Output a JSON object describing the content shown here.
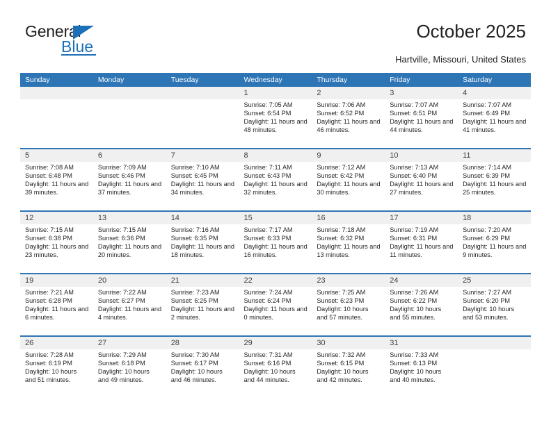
{
  "brand": {
    "name_top": "General",
    "name_bottom": "Blue",
    "accent_color": "#1c70b8",
    "triangle_icon": "blue-triangle-icon"
  },
  "header": {
    "title": "October 2025",
    "subtitle": "Hartville, Missouri, United States"
  },
  "theme": {
    "header_row_bg": "#2e75b6",
    "daynum_bg": "#f0f0f0",
    "text_color": "#262626"
  },
  "weekdays": [
    "Sunday",
    "Monday",
    "Tuesday",
    "Wednesday",
    "Thursday",
    "Friday",
    "Saturday"
  ],
  "weeks": [
    [
      {
        "day": "",
        "lines": []
      },
      {
        "day": "",
        "lines": []
      },
      {
        "day": "",
        "lines": []
      },
      {
        "day": "1",
        "lines": [
          "Sunrise: 7:05 AM",
          "Sunset: 6:54 PM",
          "Daylight: 11 hours and 48 minutes."
        ]
      },
      {
        "day": "2",
        "lines": [
          "Sunrise: 7:06 AM",
          "Sunset: 6:52 PM",
          "Daylight: 11 hours and 46 minutes."
        ]
      },
      {
        "day": "3",
        "lines": [
          "Sunrise: 7:07 AM",
          "Sunset: 6:51 PM",
          "Daylight: 11 hours and 44 minutes."
        ]
      },
      {
        "day": "4",
        "lines": [
          "Sunrise: 7:07 AM",
          "Sunset: 6:49 PM",
          "Daylight: 11 hours and 41 minutes."
        ]
      }
    ],
    [
      {
        "day": "5",
        "lines": [
          "Sunrise: 7:08 AM",
          "Sunset: 6:48 PM",
          "Daylight: 11 hours and 39 minutes."
        ]
      },
      {
        "day": "6",
        "lines": [
          "Sunrise: 7:09 AM",
          "Sunset: 6:46 PM",
          "Daylight: 11 hours and 37 minutes."
        ]
      },
      {
        "day": "7",
        "lines": [
          "Sunrise: 7:10 AM",
          "Sunset: 6:45 PM",
          "Daylight: 11 hours and 34 minutes."
        ]
      },
      {
        "day": "8",
        "lines": [
          "Sunrise: 7:11 AM",
          "Sunset: 6:43 PM",
          "Daylight: 11 hours and 32 minutes."
        ]
      },
      {
        "day": "9",
        "lines": [
          "Sunrise: 7:12 AM",
          "Sunset: 6:42 PM",
          "Daylight: 11 hours and 30 minutes."
        ]
      },
      {
        "day": "10",
        "lines": [
          "Sunrise: 7:13 AM",
          "Sunset: 6:40 PM",
          "Daylight: 11 hours and 27 minutes."
        ]
      },
      {
        "day": "11",
        "lines": [
          "Sunrise: 7:14 AM",
          "Sunset: 6:39 PM",
          "Daylight: 11 hours and 25 minutes."
        ]
      }
    ],
    [
      {
        "day": "12",
        "lines": [
          "Sunrise: 7:15 AM",
          "Sunset: 6:38 PM",
          "Daylight: 11 hours and 23 minutes."
        ]
      },
      {
        "day": "13",
        "lines": [
          "Sunrise: 7:15 AM",
          "Sunset: 6:36 PM",
          "Daylight: 11 hours and 20 minutes."
        ]
      },
      {
        "day": "14",
        "lines": [
          "Sunrise: 7:16 AM",
          "Sunset: 6:35 PM",
          "Daylight: 11 hours and 18 minutes."
        ]
      },
      {
        "day": "15",
        "lines": [
          "Sunrise: 7:17 AM",
          "Sunset: 6:33 PM",
          "Daylight: 11 hours and 16 minutes."
        ]
      },
      {
        "day": "16",
        "lines": [
          "Sunrise: 7:18 AM",
          "Sunset: 6:32 PM",
          "Daylight: 11 hours and 13 minutes."
        ]
      },
      {
        "day": "17",
        "lines": [
          "Sunrise: 7:19 AM",
          "Sunset: 6:31 PM",
          "Daylight: 11 hours and 11 minutes."
        ]
      },
      {
        "day": "18",
        "lines": [
          "Sunrise: 7:20 AM",
          "Sunset: 6:29 PM",
          "Daylight: 11 hours and 9 minutes."
        ]
      }
    ],
    [
      {
        "day": "19",
        "lines": [
          "Sunrise: 7:21 AM",
          "Sunset: 6:28 PM",
          "Daylight: 11 hours and 6 minutes."
        ]
      },
      {
        "day": "20",
        "lines": [
          "Sunrise: 7:22 AM",
          "Sunset: 6:27 PM",
          "Daylight: 11 hours and 4 minutes."
        ]
      },
      {
        "day": "21",
        "lines": [
          "Sunrise: 7:23 AM",
          "Sunset: 6:25 PM",
          "Daylight: 11 hours and 2 minutes."
        ]
      },
      {
        "day": "22",
        "lines": [
          "Sunrise: 7:24 AM",
          "Sunset: 6:24 PM",
          "Daylight: 11 hours and 0 minutes."
        ]
      },
      {
        "day": "23",
        "lines": [
          "Sunrise: 7:25 AM",
          "Sunset: 6:23 PM",
          "Daylight: 10 hours and 57 minutes."
        ]
      },
      {
        "day": "24",
        "lines": [
          "Sunrise: 7:26 AM",
          "Sunset: 6:22 PM",
          "Daylight: 10 hours and 55 minutes."
        ]
      },
      {
        "day": "25",
        "lines": [
          "Sunrise: 7:27 AM",
          "Sunset: 6:20 PM",
          "Daylight: 10 hours and 53 minutes."
        ]
      }
    ],
    [
      {
        "day": "26",
        "lines": [
          "Sunrise: 7:28 AM",
          "Sunset: 6:19 PM",
          "Daylight: 10 hours and 51 minutes."
        ]
      },
      {
        "day": "27",
        "lines": [
          "Sunrise: 7:29 AM",
          "Sunset: 6:18 PM",
          "Daylight: 10 hours and 49 minutes."
        ]
      },
      {
        "day": "28",
        "lines": [
          "Sunrise: 7:30 AM",
          "Sunset: 6:17 PM",
          "Daylight: 10 hours and 46 minutes."
        ]
      },
      {
        "day": "29",
        "lines": [
          "Sunrise: 7:31 AM",
          "Sunset: 6:16 PM",
          "Daylight: 10 hours and 44 minutes."
        ]
      },
      {
        "day": "30",
        "lines": [
          "Sunrise: 7:32 AM",
          "Sunset: 6:15 PM",
          "Daylight: 10 hours and 42 minutes."
        ]
      },
      {
        "day": "31",
        "lines": [
          "Sunrise: 7:33 AM",
          "Sunset: 6:13 PM",
          "Daylight: 10 hours and 40 minutes."
        ]
      },
      {
        "day": "",
        "lines": []
      }
    ]
  ]
}
